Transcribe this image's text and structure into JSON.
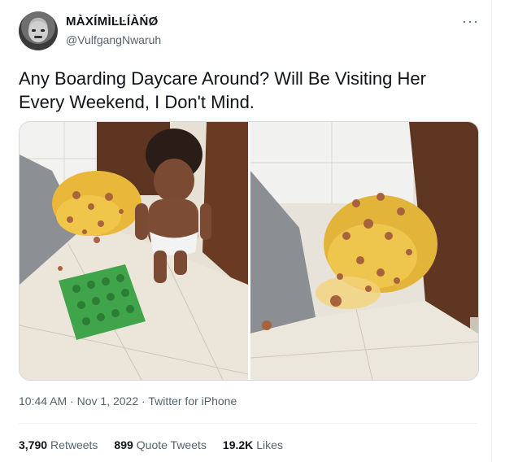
{
  "author": {
    "display_name": "MÀXÍMÌĿĿÍÀŃØ",
    "handle": "@VulfgangNwaruh"
  },
  "more_glyph": "···",
  "tweet": {
    "text": "Any Boarding Daycare Around? Will Be Visiting Her Every Weekend, I Don't Mind."
  },
  "meta": {
    "time": "10:44 AM",
    "sep1": " · ",
    "date": "Nov 1, 2022",
    "sep2": " · ",
    "source": "Twitter for iPhone"
  },
  "stats": [
    {
      "count": "3,790",
      "label": "Retweets"
    },
    {
      "count": "899",
      "label": "Quote Tweets"
    },
    {
      "count": "19.2K",
      "label": "Likes"
    }
  ],
  "icons": {
    "more": "more-icon",
    "avatar": "avatar-image"
  }
}
